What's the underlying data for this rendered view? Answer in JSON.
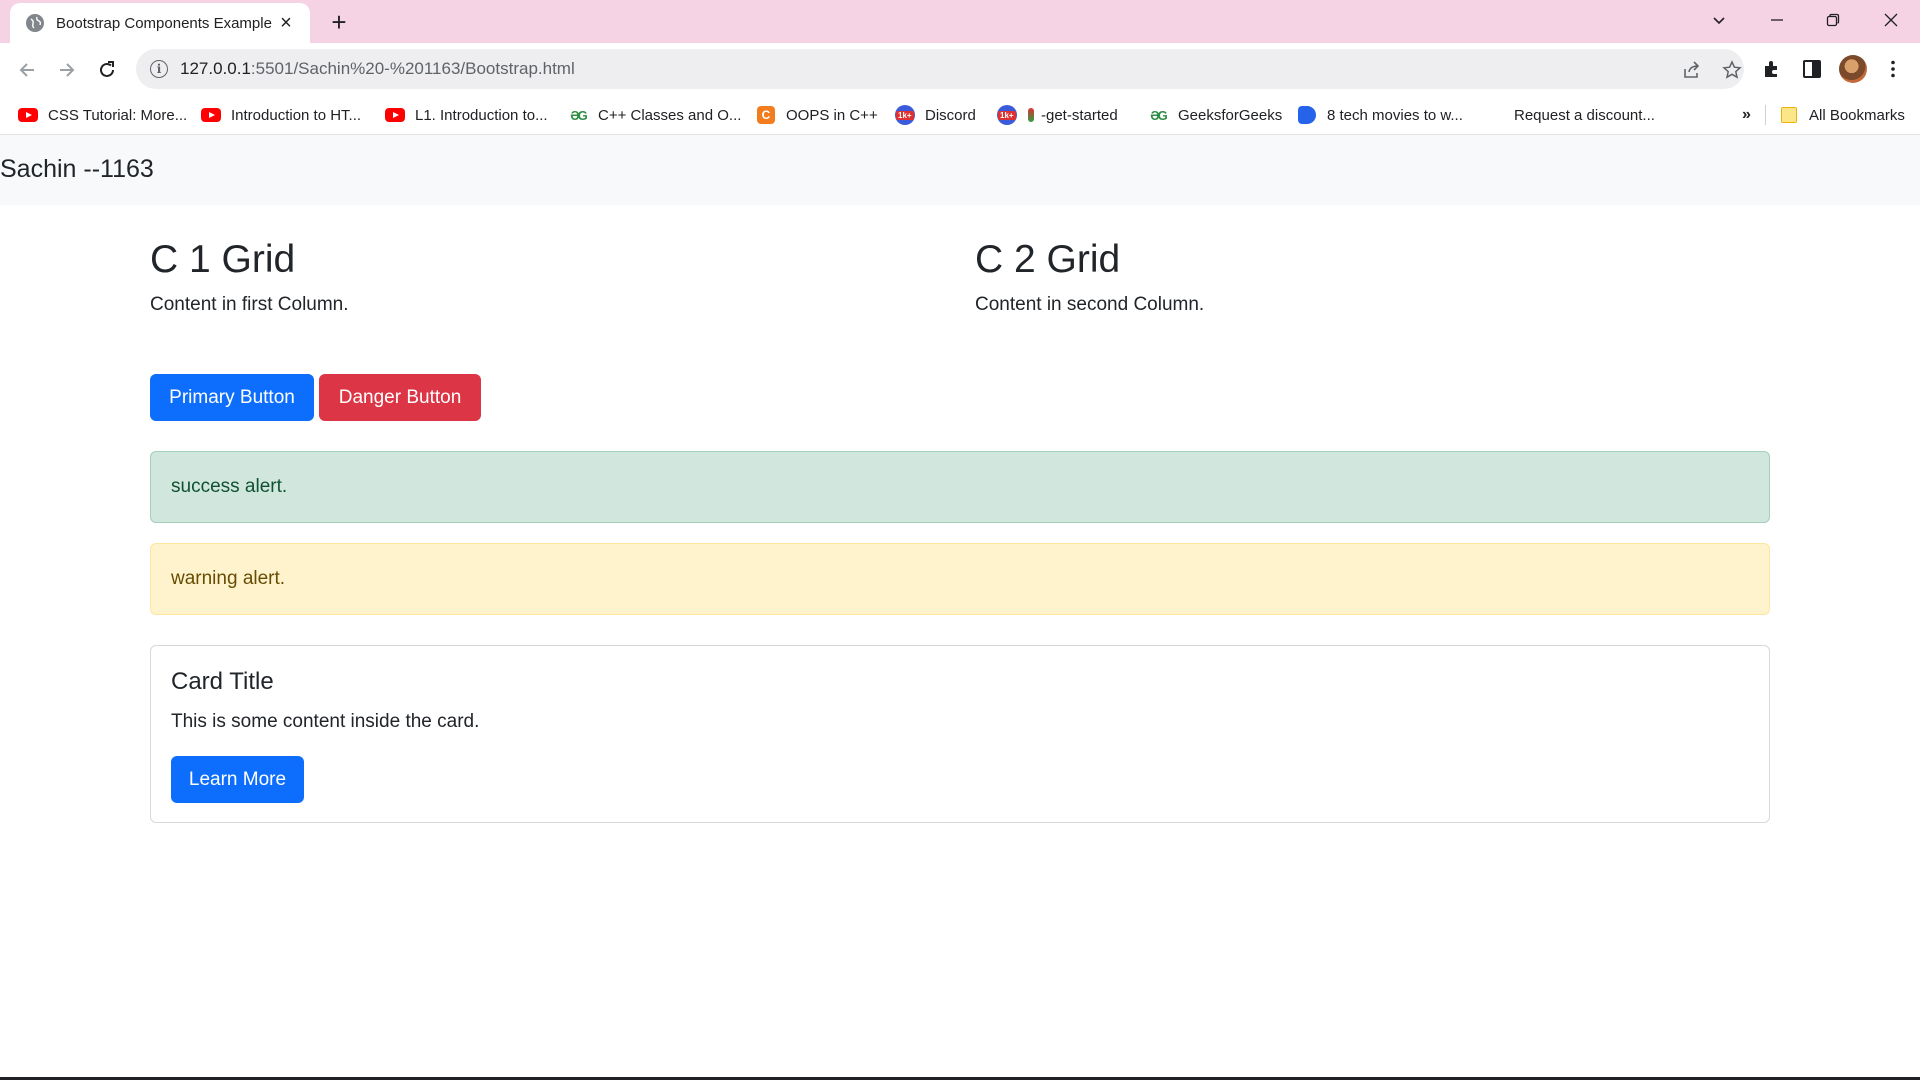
{
  "browser": {
    "tab_title": "Bootstrap Components Example",
    "tab_close": "×",
    "new_tab": "+",
    "url_host": "127.0.0.1",
    "url_rest": ":5501/Sachin%20-%201163/Bootstrap.html",
    "info_glyph": "i",
    "bookmarks": [
      {
        "label": "CSS Tutorial: More...",
        "icon": "youtube-icon"
      },
      {
        "label": "Introduction to HT...",
        "icon": "youtube-icon"
      },
      {
        "label": "L1. Introduction to...",
        "icon": "youtube-icon"
      },
      {
        "label": "C++ Classes and O...",
        "icon": "geeksforgeeks-icon"
      },
      {
        "label": "OOPS in C++",
        "icon": "codehelp-icon"
      },
      {
        "label": "Discord",
        "icon": "leetcode-icon"
      },
      {
        "label": "-get-started",
        "icon": "leetcode-icon"
      },
      {
        "label": "GeeksforGeeks",
        "icon": "geeksforgeeks-icon"
      },
      {
        "label": "8 tech movies to w...",
        "icon": "blue-icon"
      },
      {
        "label": "Request a discount...",
        "icon": "none"
      }
    ],
    "bookmarks_overflow": "»",
    "all_bookmarks": "All Bookmarks"
  },
  "page": {
    "brand": "Sachin --1163",
    "columns": [
      {
        "heading": "C 1 Grid",
        "text": "Content in first Column."
      },
      {
        "heading": "C 2 Grid",
        "text": "Content in second Column."
      }
    ],
    "buttons": {
      "primary": "Primary Button",
      "danger": "Danger Button"
    },
    "alerts": {
      "success": "success alert.",
      "warning": "warning alert."
    },
    "card": {
      "title": "Card Title",
      "text": "This is some content inside the card.",
      "button": "Learn More"
    }
  },
  "colors": {
    "primary": "#0d6efd",
    "danger": "#dc3545",
    "success_bg": "#d1e7dd",
    "warning_bg": "#fff3cd",
    "tabstrip": "#f6d3e4"
  }
}
